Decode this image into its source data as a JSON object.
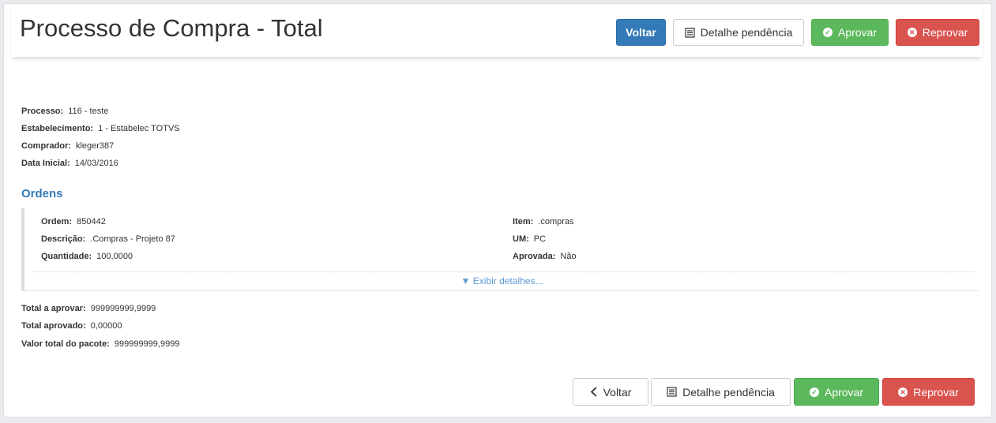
{
  "page": {
    "title": "Processo de Compra - Total"
  },
  "top_actions": {
    "back_label": "Voltar",
    "pending_label": "Detalhe pendência",
    "approve_label": "Aprovar",
    "reject_label": "Reprovar"
  },
  "process": {
    "processo_label": "Processo:",
    "processo_value": "116 - teste",
    "estabelecimento_label": "Estabelecimento:",
    "estabelecimento_value": "1 - Estabelec TOTVS",
    "comprador_label": "Comprador:",
    "comprador_value": "kleger387",
    "data_label": "Data Inicial:",
    "data_value": "14/03/2016"
  },
  "orders": {
    "title": "Ordens",
    "items": [
      {
        "ordem_label": "Ordem:",
        "ordem_value": "850442",
        "descricao_label": "Descrição:",
        "descricao_value": ".Compras - Projeto 87",
        "quantidade_label": "Quantidade:",
        "quantidade_value": "100,0000",
        "item_label": "Item:",
        "item_value": ".compras",
        "um_label": "UM:",
        "um_value": "PC",
        "aprovada_label": "Aprovada:",
        "aprovada_value": "Não"
      }
    ],
    "details_link": "▼ Exibir detalhes..."
  },
  "totals": {
    "total_aprovar_label": "Total a aprovar:",
    "total_aprovar_value": "999999999,9999",
    "total_aprovado_label": "Total aprovado:",
    "total_aprovado_value": "0,00000",
    "valor_pacote_label": "Valor total do pacote:",
    "valor_pacote_value": "999999999,9999"
  },
  "bottom_actions": {
    "back_label": "Voltar",
    "pending_label": "Detalhe pendência",
    "approve_label": "Aprovar",
    "reject_label": "Reprovar"
  },
  "icons": {
    "list": "list-icon",
    "check": "check-circle-icon",
    "close": "close-circle-icon",
    "chevron": "chevron-left-icon"
  },
  "colors": {
    "primary": "#337ab7",
    "success": "#5cb85c",
    "danger": "#d9534f",
    "link": "#5b9bd5"
  }
}
